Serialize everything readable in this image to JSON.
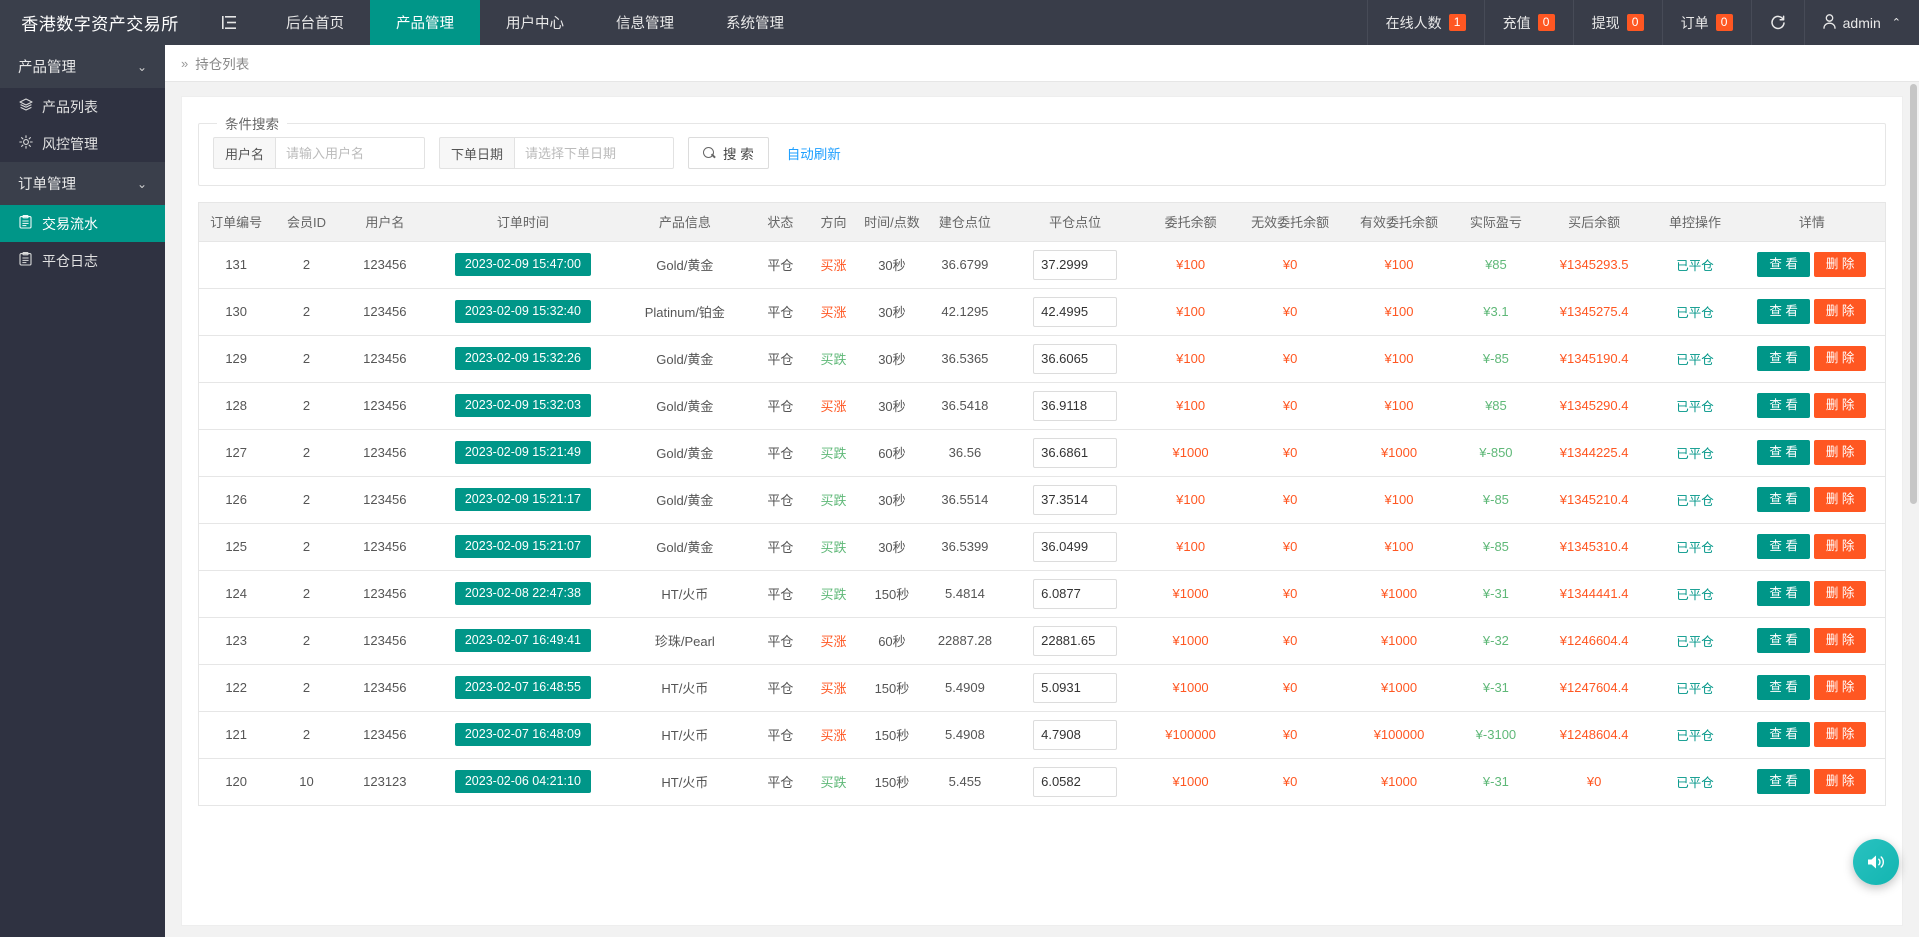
{
  "header": {
    "brand": "香港数字资产交易所",
    "menu_icon": "hamburger-icon",
    "nav": [
      {
        "label": "后台首页",
        "active": false
      },
      {
        "label": "产品管理",
        "active": true
      },
      {
        "label": "用户中心",
        "active": false
      },
      {
        "label": "信息管理",
        "active": false
      },
      {
        "label": "系统管理",
        "active": false
      }
    ],
    "stats": [
      {
        "label": "在线人数",
        "count": "1"
      },
      {
        "label": "充值",
        "count": "0"
      },
      {
        "label": "提现",
        "count": "0"
      },
      {
        "label": "订单",
        "count": "0"
      }
    ],
    "refresh_icon": "refresh-icon",
    "user": "admin",
    "user_icon": "user-icon",
    "caret": "⌃"
  },
  "sidebar": {
    "groups": [
      {
        "label": "产品管理",
        "chevron": "⌄",
        "items": [
          {
            "label": "产品列表",
            "icon": "layers-icon",
            "glyph": "◈",
            "active": false
          },
          {
            "label": "风控管理",
            "icon": "gear-icon",
            "glyph": "✲",
            "active": false
          }
        ]
      },
      {
        "label": "订单管理",
        "chevron": "⌄",
        "items": [
          {
            "label": "交易流水",
            "icon": "clipboard-icon",
            "glyph": "▤",
            "active": true
          },
          {
            "label": "平仓日志",
            "icon": "clipboard-icon",
            "glyph": "▤",
            "active": false
          }
        ]
      }
    ]
  },
  "breadcrumb": {
    "angle": "»",
    "title": "持仓列表"
  },
  "search": {
    "legend": "条件搜索",
    "username_label": "用户名",
    "username_placeholder": "请输入用户名",
    "username_value": "",
    "date_label": "下单日期",
    "date_placeholder": "请选择下单日期",
    "date_value": "",
    "search_button": "搜 索",
    "search_icon": "search-icon",
    "auto_refresh": "自动刷新"
  },
  "table": {
    "columns": [
      "订单编号",
      "会员ID",
      "用户名",
      "订单时间",
      "产品信息",
      "状态",
      "方向",
      "时间/点数",
      "建仓点位",
      "平仓点位",
      "委托余额",
      "无效委托余额",
      "有效委托余额",
      "实际盈亏",
      "买后余额",
      "单控操作",
      "详情"
    ],
    "view_label": "查 看",
    "delete_label": "删 除",
    "rows": [
      {
        "id": "131",
        "member": "2",
        "user": "123456",
        "time": "2023-02-09 15:47:00",
        "product": "Gold/黄金",
        "status": "平仓",
        "dir": "买涨",
        "dir_type": "red",
        "period": "30秒",
        "open": "36.6799",
        "close": "37.2999",
        "entrust": "¥100",
        "invalid": "¥0",
        "valid": "¥100",
        "pnl": "¥85",
        "pnl_type": "green",
        "balance": "¥1345293.5",
        "control": "已平仓"
      },
      {
        "id": "130",
        "member": "2",
        "user": "123456",
        "time": "2023-02-09 15:32:40",
        "product": "Platinum/铂金",
        "status": "平仓",
        "dir": "买涨",
        "dir_type": "red",
        "period": "30秒",
        "open": "42.1295",
        "close": "42.4995",
        "entrust": "¥100",
        "invalid": "¥0",
        "valid": "¥100",
        "pnl": "¥3.1",
        "pnl_type": "green",
        "balance": "¥1345275.4",
        "control": "已平仓"
      },
      {
        "id": "129",
        "member": "2",
        "user": "123456",
        "time": "2023-02-09 15:32:26",
        "product": "Gold/黄金",
        "status": "平仓",
        "dir": "买跌",
        "dir_type": "green",
        "period": "30秒",
        "open": "36.5365",
        "close": "36.6065",
        "entrust": "¥100",
        "invalid": "¥0",
        "valid": "¥100",
        "pnl": "¥-85",
        "pnl_type": "green",
        "balance": "¥1345190.4",
        "control": "已平仓"
      },
      {
        "id": "128",
        "member": "2",
        "user": "123456",
        "time": "2023-02-09 15:32:03",
        "product": "Gold/黄金",
        "status": "平仓",
        "dir": "买涨",
        "dir_type": "red",
        "period": "30秒",
        "open": "36.5418",
        "close": "36.9118",
        "entrust": "¥100",
        "invalid": "¥0",
        "valid": "¥100",
        "pnl": "¥85",
        "pnl_type": "green",
        "balance": "¥1345290.4",
        "control": "已平仓"
      },
      {
        "id": "127",
        "member": "2",
        "user": "123456",
        "time": "2023-02-09 15:21:49",
        "product": "Gold/黄金",
        "status": "平仓",
        "dir": "买跌",
        "dir_type": "green",
        "period": "60秒",
        "open": "36.56",
        "close": "36.6861",
        "entrust": "¥1000",
        "invalid": "¥0",
        "valid": "¥1000",
        "pnl": "¥-850",
        "pnl_type": "green",
        "balance": "¥1344225.4",
        "control": "已平仓"
      },
      {
        "id": "126",
        "member": "2",
        "user": "123456",
        "time": "2023-02-09 15:21:17",
        "product": "Gold/黄金",
        "status": "平仓",
        "dir": "买跌",
        "dir_type": "green",
        "period": "30秒",
        "open": "36.5514",
        "close": "37.3514",
        "entrust": "¥100",
        "invalid": "¥0",
        "valid": "¥100",
        "pnl": "¥-85",
        "pnl_type": "green",
        "balance": "¥1345210.4",
        "control": "已平仓"
      },
      {
        "id": "125",
        "member": "2",
        "user": "123456",
        "time": "2023-02-09 15:21:07",
        "product": "Gold/黄金",
        "status": "平仓",
        "dir": "买跌",
        "dir_type": "green",
        "period": "30秒",
        "open": "36.5399",
        "close": "36.0499",
        "entrust": "¥100",
        "invalid": "¥0",
        "valid": "¥100",
        "pnl": "¥-85",
        "pnl_type": "green",
        "balance": "¥1345310.4",
        "control": "已平仓"
      },
      {
        "id": "124",
        "member": "2",
        "user": "123456",
        "time": "2023-02-08 22:47:38",
        "product": "HT/火币",
        "status": "平仓",
        "dir": "买跌",
        "dir_type": "green",
        "period": "150秒",
        "open": "5.4814",
        "close": "6.0877",
        "entrust": "¥1000",
        "invalid": "¥0",
        "valid": "¥1000",
        "pnl": "¥-31",
        "pnl_type": "green",
        "balance": "¥1344441.4",
        "control": "已平仓"
      },
      {
        "id": "123",
        "member": "2",
        "user": "123456",
        "time": "2023-02-07 16:49:41",
        "product": "珍珠/Pearl",
        "status": "平仓",
        "dir": "买涨",
        "dir_type": "red",
        "period": "60秒",
        "open": "22887.28",
        "close": "22881.65",
        "entrust": "¥1000",
        "invalid": "¥0",
        "valid": "¥1000",
        "pnl": "¥-32",
        "pnl_type": "green",
        "balance": "¥1246604.4",
        "control": "已平仓"
      },
      {
        "id": "122",
        "member": "2",
        "user": "123456",
        "time": "2023-02-07 16:48:55",
        "product": "HT/火币",
        "status": "平仓",
        "dir": "买涨",
        "dir_type": "red",
        "period": "150秒",
        "open": "5.4909",
        "close": "5.0931",
        "entrust": "¥1000",
        "invalid": "¥0",
        "valid": "¥1000",
        "pnl": "¥-31",
        "pnl_type": "green",
        "balance": "¥1247604.4",
        "control": "已平仓"
      },
      {
        "id": "121",
        "member": "2",
        "user": "123456",
        "time": "2023-02-07 16:48:09",
        "product": "HT/火币",
        "status": "平仓",
        "dir": "买涨",
        "dir_type": "red",
        "period": "150秒",
        "open": "5.4908",
        "close": "4.7908",
        "entrust": "¥100000",
        "invalid": "¥0",
        "valid": "¥100000",
        "pnl": "¥-3100",
        "pnl_type": "green",
        "balance": "¥1248604.4",
        "control": "已平仓"
      },
      {
        "id": "120",
        "member": "10",
        "user": "123123",
        "time": "2023-02-06 04:21:10",
        "product": "HT/火币",
        "status": "平仓",
        "dir": "买跌",
        "dir_type": "green",
        "period": "150秒",
        "open": "5.455",
        "close": "6.0582",
        "entrust": "¥1000",
        "invalid": "¥0",
        "valid": "¥1000",
        "pnl": "¥-31",
        "pnl_type": "green",
        "balance": "¥0",
        "control": "已平仓"
      }
    ]
  },
  "fab": {
    "icon": "volume-icon",
    "glyph": "🔊"
  },
  "colors": {
    "brand_dark": "#393D49",
    "sidebar": "#2F3241",
    "accent_teal": "#009688",
    "accent_orange": "#FF5722",
    "link_blue": "#1E9FFF",
    "green": "#5FB878"
  }
}
